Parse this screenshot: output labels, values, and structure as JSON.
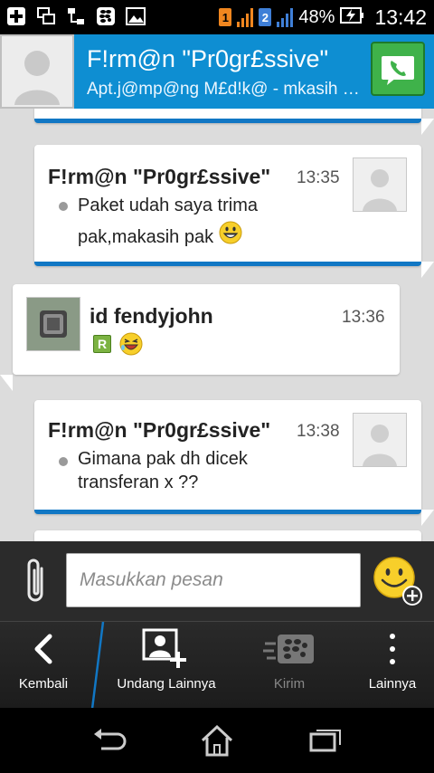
{
  "status_bar": {
    "sim1": "1",
    "sim2": "2",
    "battery_percent": "48%",
    "time": "13:42",
    "icons": [
      "add-icon",
      "screens-icon",
      "network-icon",
      "bbm-icon",
      "image-icon"
    ]
  },
  "header": {
    "contact_name": "F!rm@n \"Pr0gr£ssive\"",
    "status_message": "Apt.j@mp@ng M£d!k@ - mkasih banyak",
    "call_icon": "phone-icon",
    "colors": {
      "bar": "#0e8ed2",
      "call": "#3fb24a"
    }
  },
  "messages": [
    {
      "sender": "F!rm@n \"Pr0gr£ssive\"",
      "time": "13:35",
      "text_line1": "Paket udah saya trima",
      "text_line2": "pak,makasih pak",
      "emoji": "grin-emoji"
    },
    {
      "sender": "id fendyjohn",
      "time": "13:36",
      "status": "R",
      "emoji": "laughing-emoji"
    },
    {
      "sender": "F!rm@n \"Pr0gr£ssive\"",
      "time": "13:38",
      "text_line1": "Gimana pak dh dicek",
      "text_line2": "transferan x ??"
    }
  ],
  "composer": {
    "placeholder": "Masukkan pesan",
    "attach_icon": "paperclip-icon",
    "emoticon_icon": "smiley-add-icon"
  },
  "action_bar": {
    "back_label": "Kembali",
    "invite_label": "Undang Lainnya",
    "send_label": "Kirim",
    "more_label": "Lainnya",
    "accent": "#1177c4"
  },
  "nav_bar": {
    "buttons": [
      "back-icon",
      "home-icon",
      "recents-icon"
    ]
  }
}
